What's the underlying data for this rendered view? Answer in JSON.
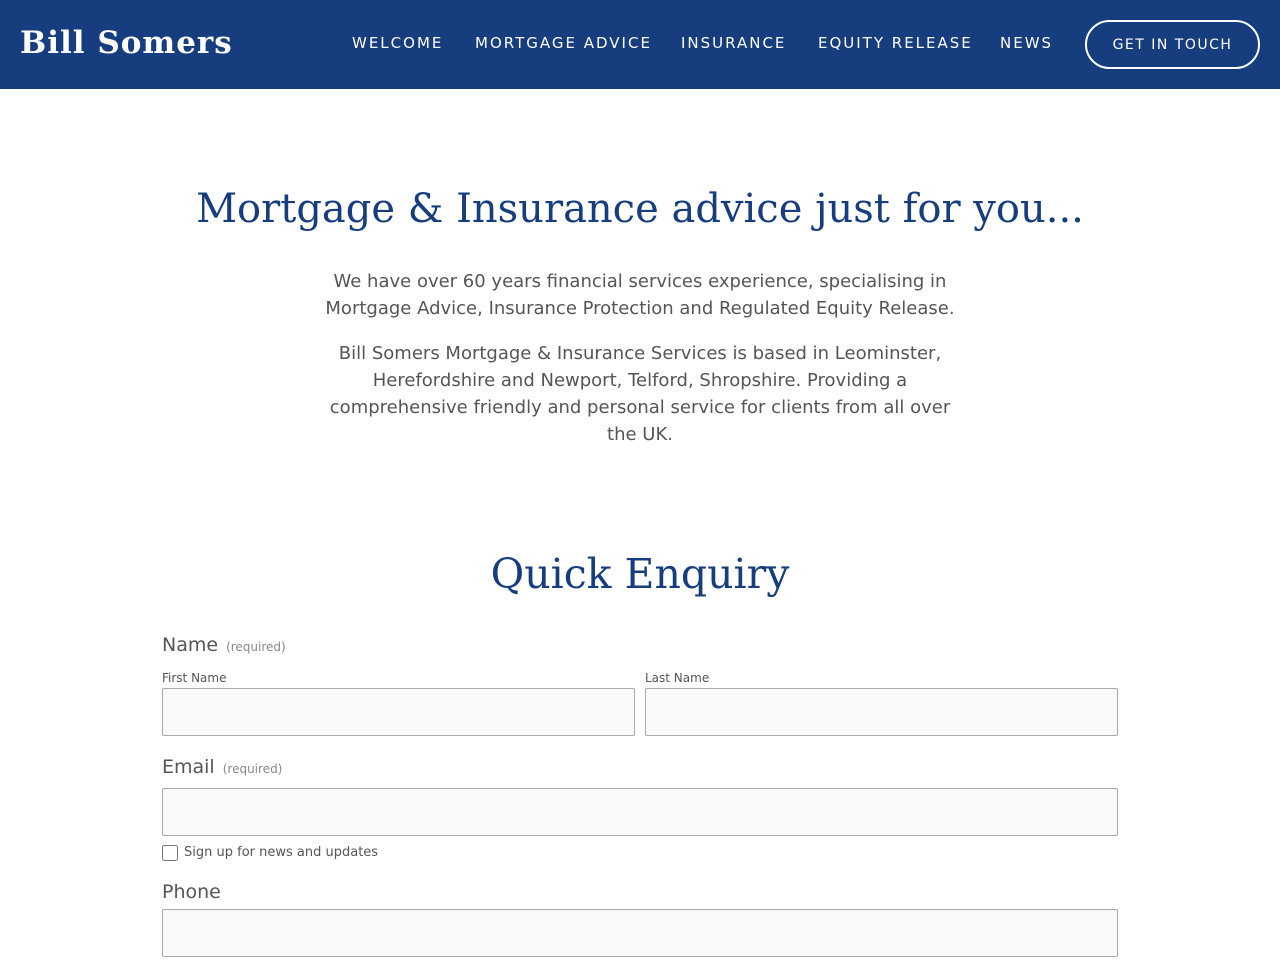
{
  "header": {
    "logo": "Bill Somers",
    "nav": [
      {
        "label": "WELCOME"
      },
      {
        "label": "MORTGAGE ADVICE"
      },
      {
        "label": "INSURANCE"
      },
      {
        "label": "EQUITY RELEASE"
      },
      {
        "label": "NEWS"
      }
    ],
    "cta_label": "GET IN TOUCH"
  },
  "hero": {
    "title": "Mortgage & Insurance advice just for you...",
    "paragraph_1": "We have over 60 years financial services experience, specialising in Mortgage Advice, Insurance Protection and Regulated Equity Release.",
    "paragraph_2": "Bill Somers Mortgage & Insurance Services is based in Leominster, Herefordshire and Newport, Telford, Shropshire. Providing a comprehensive friendly and personal service for clients from all over the UK."
  },
  "form": {
    "title": "Quick Enquiry",
    "name_label": "Name",
    "name_required": "(required)",
    "first_name_label": "First Name",
    "first_name_value": "",
    "last_name_label": "Last Name",
    "last_name_value": "",
    "email_label": "Email",
    "email_required": "(required)",
    "email_value": "",
    "newsletter_label": "Sign up for news and updates",
    "phone_label": "Phone",
    "phone_value": ""
  },
  "colors": {
    "brand_blue": "#163d7e",
    "body_text": "#555555",
    "input_bg": "#fafafa",
    "input_border": "#a9a9a9"
  }
}
